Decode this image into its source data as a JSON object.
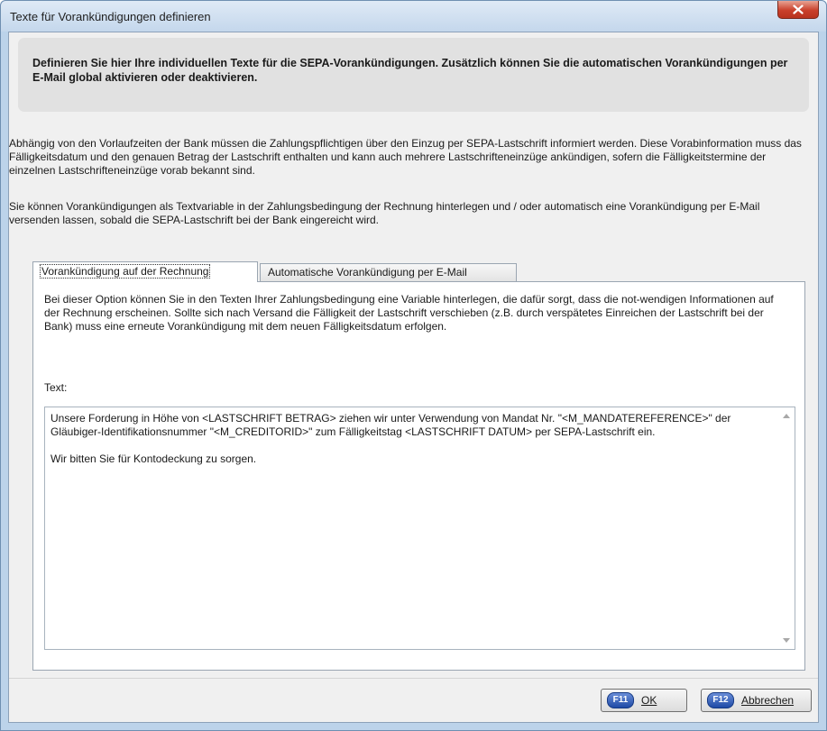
{
  "window": {
    "title": "Texte für Vorankündigungen definieren"
  },
  "banner": {
    "text": "Definieren Sie hier Ihre individuellen Texte für die SEPA-Vorankündigungen. Zusätzlich können Sie die automatischen Vorankündigungen per E-Mail global aktivieren oder deaktivieren."
  },
  "intro": {
    "paragraph1": "Abhängig von den Vorlaufzeiten der Bank müssen die Zahlungspflichtigen über den Einzug per SEPA-Lastschrift informiert werden. Diese Vorabinformation muss das Fälligkeitsdatum und den genauen Betrag der Lastschrift enthalten und kann auch mehrere Lastschrifteneinzüge ankündigen, sofern die Fälligkeitstermine der einzelnen Lastschrifteneinzüge vorab bekannt sind.",
    "paragraph2": "Sie können Vorankündigungen als Textvariable in der Zahlungsbedingung der Rechnung hinterlegen und / oder automatisch eine Vorankündigung per E-Mail versenden lassen, sobald die SEPA-Lastschrift bei der Bank eingereicht wird."
  },
  "tabs": [
    {
      "label": "Vorankündigung auf der Rechnung",
      "active": true
    },
    {
      "label": "Automatische Vorankündigung per E-Mail",
      "active": false
    }
  ],
  "panel": {
    "description": "Bei dieser Option können Sie in den Texten Ihrer Zahlungsbedingung eine Variable hinterlegen, die dafür sorgt, dass die not-wendigen Informationen auf der Rechnung erscheinen. Sollte sich nach Versand die Fälligkeit der Lastschrift verschieben (z.B. durch verspätetes Einreichen der Lastschrift bei der Bank) muss eine erneute Vorankündigung mit dem neuen Fälligkeitsdatum erfolgen.",
    "text_label": "Text:",
    "text_value": "Unsere Forderung in Höhe von <LASTSCHRIFT BETRAG> ziehen wir unter Verwendung von Mandat Nr. \"<M_MANDATEREFERENCE>\" der Gläubiger-Identifikationsnummer \"<M_CREDITORID>\" zum Fälligkeitstag <LASTSCHRIFT DATUM> per SEPA-Lastschrift ein.\n\nWir bitten Sie für Kontodeckung zu sorgen."
  },
  "buttons": {
    "ok": {
      "key": "F11",
      "label": "OK"
    },
    "cancel": {
      "key": "F12",
      "label": "Abbrechen"
    }
  }
}
